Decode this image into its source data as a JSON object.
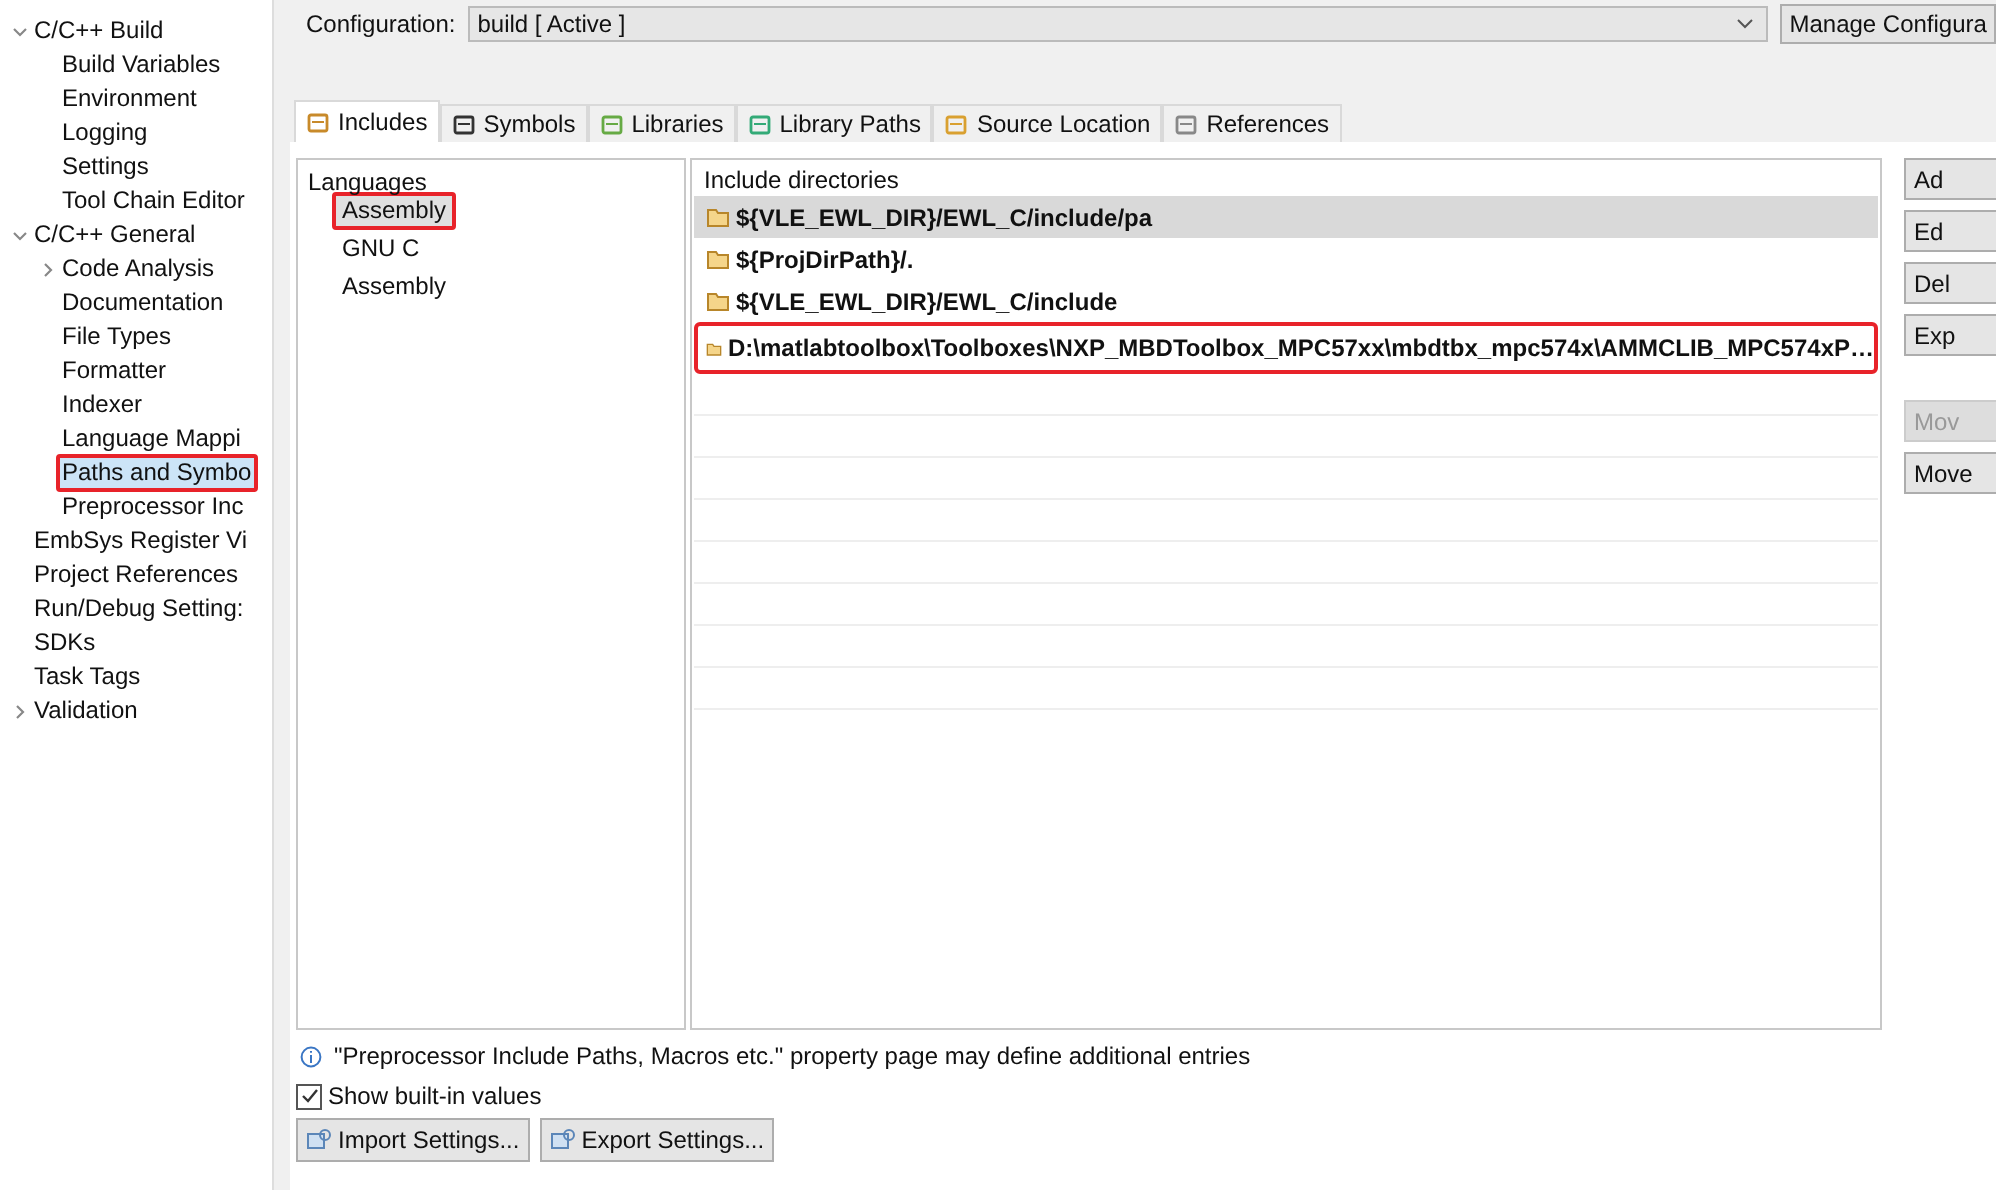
{
  "sidebar": {
    "items": [
      {
        "label": "C/C++ Build",
        "expanded": true,
        "selected": false,
        "highlighted": false,
        "children": [
          {
            "label": "Build Variables",
            "selected": false,
            "highlighted": false
          },
          {
            "label": "Environment",
            "selected": false,
            "highlighted": false
          },
          {
            "label": "Logging",
            "selected": false,
            "highlighted": false
          },
          {
            "label": "Settings",
            "selected": false,
            "highlighted": false
          },
          {
            "label": "Tool Chain Editor",
            "selected": false,
            "highlighted": false
          }
        ]
      },
      {
        "label": "C/C++ General",
        "expanded": true,
        "selected": false,
        "highlighted": false,
        "children": [
          {
            "label": "Code Analysis",
            "expanded": false,
            "selected": false,
            "highlighted": false
          },
          {
            "label": "Documentation",
            "selected": false,
            "highlighted": false
          },
          {
            "label": "File Types",
            "selected": false,
            "highlighted": false
          },
          {
            "label": "Formatter",
            "selected": false,
            "highlighted": false
          },
          {
            "label": "Indexer",
            "selected": false,
            "highlighted": false
          },
          {
            "label": "Language Mappi",
            "selected": false,
            "highlighted": false
          },
          {
            "label": "Paths and Symbo",
            "selected": true,
            "highlighted": true
          },
          {
            "label": "Preprocessor Inc",
            "selected": false,
            "highlighted": false
          }
        ]
      },
      {
        "label": "EmbSys Register Vi",
        "selected": false,
        "highlighted": false
      },
      {
        "label": "Project References",
        "selected": false,
        "highlighted": false
      },
      {
        "label": "Run/Debug Setting:",
        "selected": false,
        "highlighted": false
      },
      {
        "label": "SDKs",
        "selected": false,
        "highlighted": false
      },
      {
        "label": "Task Tags",
        "selected": false,
        "highlighted": false
      },
      {
        "label": "Validation",
        "expanded": false,
        "selected": false,
        "highlighted": false
      }
    ]
  },
  "configuration": {
    "label": "Configuration:",
    "value": "build  [ Active ]",
    "button": "Manage Configura"
  },
  "tabs": [
    {
      "label": "Includes",
      "selected": true
    },
    {
      "label": "Symbols",
      "selected": false
    },
    {
      "label": "Libraries",
      "selected": false
    },
    {
      "label": "Library Paths",
      "selected": false
    },
    {
      "label": "Source Location",
      "selected": false
    },
    {
      "label": "References",
      "selected": false
    }
  ],
  "languages": {
    "header": "Languages",
    "items": [
      {
        "label": "Assembly",
        "selected": true,
        "highlighted": true
      },
      {
        "label": "GNU C",
        "selected": false,
        "highlighted": false
      },
      {
        "label": "Assembly",
        "selected": false,
        "highlighted": false
      }
    ]
  },
  "include_directories": {
    "header": "Include directories",
    "rows": [
      {
        "path": "${VLE_EWL_DIR}/EWL_C/include/pa",
        "selected": true,
        "highlighted": false
      },
      {
        "path": "${ProjDirPath}/.",
        "selected": false,
        "highlighted": false
      },
      {
        "path": "${VLE_EWL_DIR}/EWL_C/include",
        "selected": false,
        "highlighted": false
      },
      {
        "path": "D:\\matlabtoolbox\\Toolboxes\\NXP_MBDToolbox_MPC57xx\\mbdtbx_mpc574x\\AMMCLIB_MPC574xP…",
        "selected": false,
        "highlighted": true
      }
    ]
  },
  "side_buttons_top": [
    {
      "label": "Ad",
      "disabled": false
    },
    {
      "label": "Ed",
      "disabled": false
    },
    {
      "label": "Del",
      "disabled": false
    },
    {
      "label": "Exp",
      "disabled": false
    }
  ],
  "side_buttons_bottom": [
    {
      "label": "Mov",
      "disabled": true
    },
    {
      "label": "Move",
      "disabled": false
    }
  ],
  "info": "\"Preprocessor Include Paths, Macros etc.\" property page may define additional entries",
  "show_builtin": {
    "label": "Show built-in values",
    "checked": true
  },
  "bottom_buttons": [
    "Import Settings...",
    "Export Settings..."
  ]
}
